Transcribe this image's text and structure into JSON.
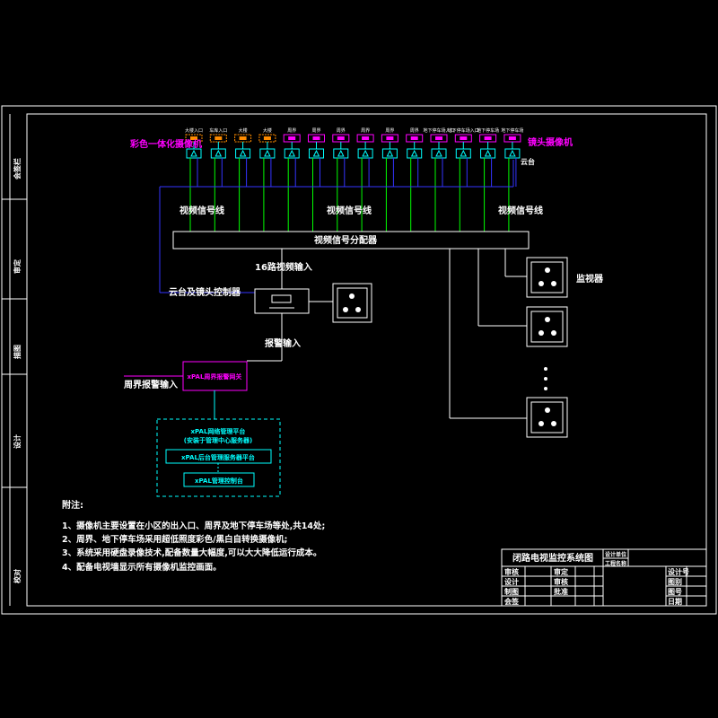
{
  "diagram": {
    "camera_labels": [
      "大楼入口",
      "车库入口",
      "大楼",
      "大楼",
      "周界",
      "周界",
      "周界",
      "周界",
      "周界",
      "周界",
      "地下停车场入口",
      "地下停车场入口",
      "地下停车场",
      "地下停车场"
    ],
    "color_camera_label": "彩色一体化摄像机",
    "ptz_camera_label": "镜头摄像机",
    "ptz_label": "云台",
    "video_line_labels": [
      "视频信号线",
      "视频信号线",
      "视频信号线"
    ],
    "distributor_label": "视频信号分配器",
    "input16_label": "16路视频输入",
    "ptz_control_label": "云台及镜头控制器",
    "monitor_label": "监视器",
    "alarm_input_label": "报警输入",
    "perimeter_alarm_label": "周界报警输入",
    "alarm_gateway_label": "xPAL周界报警网关",
    "platform_title": "xPAL网络管理平台",
    "platform_subtitle": "(安装于管理中心服务器)",
    "platform_server": "xPAL后台管理服务器平台",
    "platform_client": "xPAL管理控制台",
    "notes_title": "附注:",
    "notes": [
      "1、摄像机主要设置在小区的出入口、周界及地下停车场等处,共14处;",
      "2、周界、地下停车场采用超低照度彩色/黑白自转换摄像机;",
      "3、系统采用硬盘录像技术,配备数量大幅度,可以大大降低运行成本。",
      "4、配备电视墙显示所有摄像机监控画面。"
    ],
    "colors": {
      "orange": "#ff8c00",
      "magenta": "#ff00ff",
      "cyan": "#00ffff",
      "green": "#00ff00",
      "blue": "#3333ff",
      "white": "#ffffff"
    }
  },
  "title_block": {
    "title": "闭路电视监控系统图",
    "stamp": [
      "设计单位",
      "工程名称"
    ],
    "left_rows": [
      [
        "审核",
        "审定"
      ],
      [
        "设计",
        "审核"
      ],
      [
        "制图",
        "批准"
      ],
      [
        "会签",
        ""
      ]
    ],
    "right_rows": [
      "设计号",
      "图别",
      "图号",
      "日期"
    ]
  },
  "side_strip": [
    "会签栏",
    "审定",
    "描图",
    "设计",
    "校对"
  ]
}
